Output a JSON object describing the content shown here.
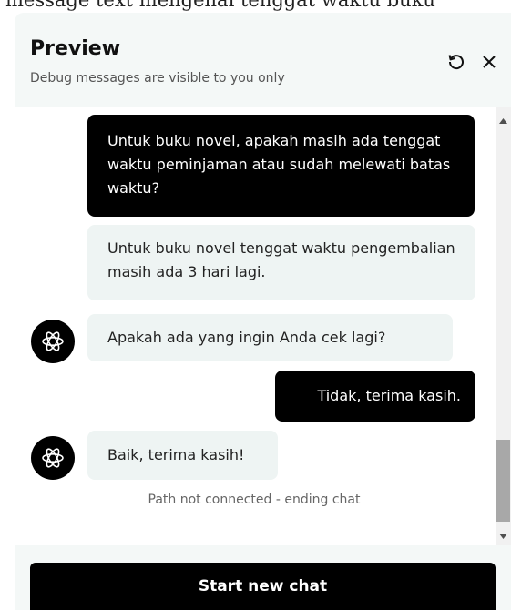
{
  "background_text": "message text mengenai tenggat waktu buku",
  "panel": {
    "title": "Preview",
    "subtitle": "Debug messages are visible to you only",
    "refresh_icon": "refresh-icon",
    "close_icon": "close-icon"
  },
  "messages": [
    {
      "role": "user",
      "text": "Untuk buku novel, apakah masih ada tenggat waktu peminjaman atau sudah melewati batas waktu?"
    },
    {
      "role": "bot",
      "text": "Untuk buku novel tenggat waktu pengembalian masih ada 3 hari lagi."
    },
    {
      "role": "bot",
      "text": "Apakah ada yang ingin Anda cek lagi?",
      "avatar": "assistant-logo-icon"
    },
    {
      "role": "user",
      "text": "Tidak, terima kasih."
    },
    {
      "role": "bot",
      "text": "Baik, terima kasih!",
      "avatar": "assistant-logo-icon"
    }
  ],
  "status_text": "Path not connected - ending chat",
  "footer": {
    "button_label": "Start new chat"
  },
  "colors": {
    "user_bubble": "#000000",
    "bot_bubble": "#eef4f3",
    "panel_bg": "#f4f8f7"
  }
}
